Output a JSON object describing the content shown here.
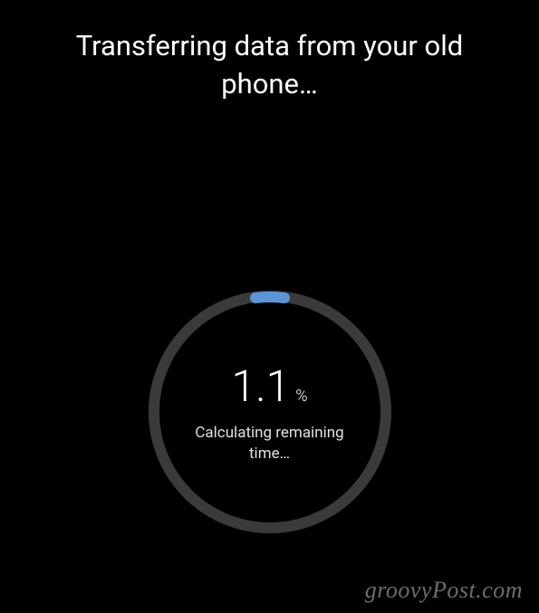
{
  "header": {
    "title": "Transferring data from your old phone…"
  },
  "progress": {
    "value": "1.1",
    "symbol": "%",
    "status": "Calculating remaining time…",
    "ring_bg": "#3a3a3a",
    "ring_fg": "#5a95d6"
  },
  "watermark": "groovyPost.com"
}
